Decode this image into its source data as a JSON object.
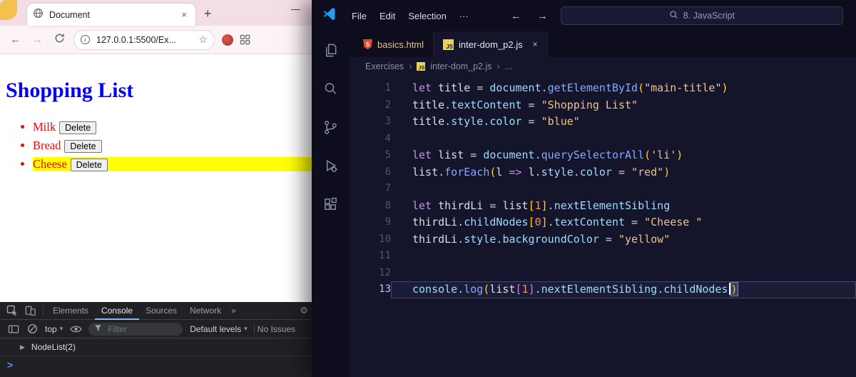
{
  "icons": {
    "tab_close": "×",
    "new_tab": "+",
    "minimize": "—",
    "back": "←",
    "forward": "→",
    "info": "i",
    "star": "☆",
    "more": "···",
    "overflow_tabs": "»",
    "gear": "⚙",
    "dropdown": "▾",
    "expand": "▶",
    "prompt": ">",
    "breadcrumb_sep": "›",
    "js_badge": "JS",
    "html_badge": "5"
  },
  "colors": {
    "page_title_blue": "#0000ff",
    "list_item_red": "#ff0000",
    "highlight_yellow": "#ffff00",
    "modified_tab_orange": "#e2c08d",
    "devtools_accent_blue": "#8ab4f8",
    "vscode_logo_blue": "#289bf0"
  },
  "browser": {
    "tab_title": "Document",
    "url": "127.0.0.1:5500/Ex...",
    "page": {
      "title": "Shopping List",
      "list": [
        {
          "label": "Milk",
          "button": "Delete",
          "highlight": false
        },
        {
          "label": "Bread",
          "button": "Delete",
          "highlight": false
        },
        {
          "label": "Cheese",
          "button": "Delete",
          "highlight": true
        }
      ]
    },
    "devtools": {
      "tabs": [
        "Elements",
        "Console",
        "Sources",
        "Network"
      ],
      "active_tab": "Console",
      "context_selector": "top",
      "filter_placeholder": "Filter",
      "levels_label": "Default levels",
      "issues_label": "No Issues",
      "output": "NodeList(2)"
    }
  },
  "vscode": {
    "menus": [
      "File",
      "Edit",
      "Selection"
    ],
    "search_label": "8. JavaScript",
    "tabs": [
      {
        "label": "basics.html",
        "icon": "html",
        "active": false
      },
      {
        "label": "inter-dom_p2.js",
        "icon": "js",
        "active": true
      }
    ],
    "breadcrumb": [
      "Exercises",
      "inter-dom_p2.js",
      "..."
    ],
    "code": {
      "lines": [
        {
          "n": 1,
          "tokens": [
            [
              "kw",
              "let "
            ],
            [
              "vr",
              "title "
            ],
            [
              "op",
              "= "
            ],
            [
              "prop",
              "document"
            ],
            [
              "op",
              "."
            ],
            [
              "fn",
              "getElementById"
            ],
            [
              "br",
              "("
            ],
            [
              "st",
              "\"main-title\""
            ],
            [
              "br",
              ")"
            ]
          ]
        },
        {
          "n": 2,
          "tokens": [
            [
              "vr",
              "title"
            ],
            [
              "op",
              "."
            ],
            [
              "prop",
              "textContent"
            ],
            [
              "op",
              " = "
            ],
            [
              "st",
              "\"Shopping List\""
            ]
          ]
        },
        {
          "n": 3,
          "tokens": [
            [
              "vr",
              "title"
            ],
            [
              "op",
              "."
            ],
            [
              "prop",
              "style"
            ],
            [
              "op",
              "."
            ],
            [
              "prop",
              "color"
            ],
            [
              "op",
              " = "
            ],
            [
              "st",
              "\"blue\""
            ]
          ]
        },
        {
          "n": 4,
          "tokens": []
        },
        {
          "n": 5,
          "tokens": [
            [
              "kw",
              "let "
            ],
            [
              "vr",
              "list "
            ],
            [
              "op",
              "= "
            ],
            [
              "prop",
              "document"
            ],
            [
              "op",
              "."
            ],
            [
              "fn",
              "querySelectorAll"
            ],
            [
              "br",
              "("
            ],
            [
              "st",
              "'li'"
            ],
            [
              "br",
              ")"
            ]
          ]
        },
        {
          "n": 6,
          "tokens": [
            [
              "vr",
              "list"
            ],
            [
              "op",
              "."
            ],
            [
              "fn",
              "forEach"
            ],
            [
              "br",
              "("
            ],
            [
              "vr",
              "l "
            ],
            [
              "kw",
              "=> "
            ],
            [
              "vr",
              "l"
            ],
            [
              "op",
              "."
            ],
            [
              "prop",
              "style"
            ],
            [
              "op",
              "."
            ],
            [
              "prop",
              "color"
            ],
            [
              "op",
              " = "
            ],
            [
              "st",
              "\"red\""
            ],
            [
              "br",
              ")"
            ]
          ]
        },
        {
          "n": 7,
          "tokens": []
        },
        {
          "n": 8,
          "tokens": [
            [
              "kw",
              "let "
            ],
            [
              "vr",
              "thirdLi "
            ],
            [
              "op",
              "= "
            ],
            [
              "vr",
              "list"
            ],
            [
              "br",
              "["
            ],
            [
              "num",
              "1"
            ],
            [
              "br",
              "]"
            ],
            [
              "op",
              "."
            ],
            [
              "prop",
              "nextElementSibling"
            ]
          ]
        },
        {
          "n": 9,
          "tokens": [
            [
              "vr",
              "thirdLi"
            ],
            [
              "op",
              "."
            ],
            [
              "prop",
              "childNodes"
            ],
            [
              "br",
              "["
            ],
            [
              "num",
              "0"
            ],
            [
              "br",
              "]"
            ],
            [
              "op",
              "."
            ],
            [
              "prop",
              "textContent"
            ],
            [
              "op",
              " = "
            ],
            [
              "st",
              "\"Cheese \""
            ]
          ]
        },
        {
          "n": 10,
          "tokens": [
            [
              "vr",
              "thirdLi"
            ],
            [
              "op",
              "."
            ],
            [
              "prop",
              "style"
            ],
            [
              "op",
              "."
            ],
            [
              "prop",
              "backgroundColor"
            ],
            [
              "op",
              " = "
            ],
            [
              "st",
              "\"yellow\""
            ]
          ]
        },
        {
          "n": 11,
          "tokens": []
        },
        {
          "n": 12,
          "tokens": []
        },
        {
          "n": 13,
          "current": true,
          "tokens": [
            [
              "prop",
              "console"
            ],
            [
              "op",
              "."
            ],
            [
              "fn",
              "log"
            ],
            [
              "br",
              "("
            ],
            [
              "vr",
              "list"
            ],
            [
              "br2",
              "["
            ],
            [
              "num",
              "1"
            ],
            [
              "br2",
              "]"
            ],
            [
              "op",
              "."
            ],
            [
              "prop",
              "nextElementSibling"
            ],
            [
              "op",
              "."
            ],
            [
              "prop",
              "childNodes"
            ],
            [
              "cursor",
              ""
            ],
            [
              "brm",
              ")"
            ]
          ]
        }
      ]
    }
  }
}
